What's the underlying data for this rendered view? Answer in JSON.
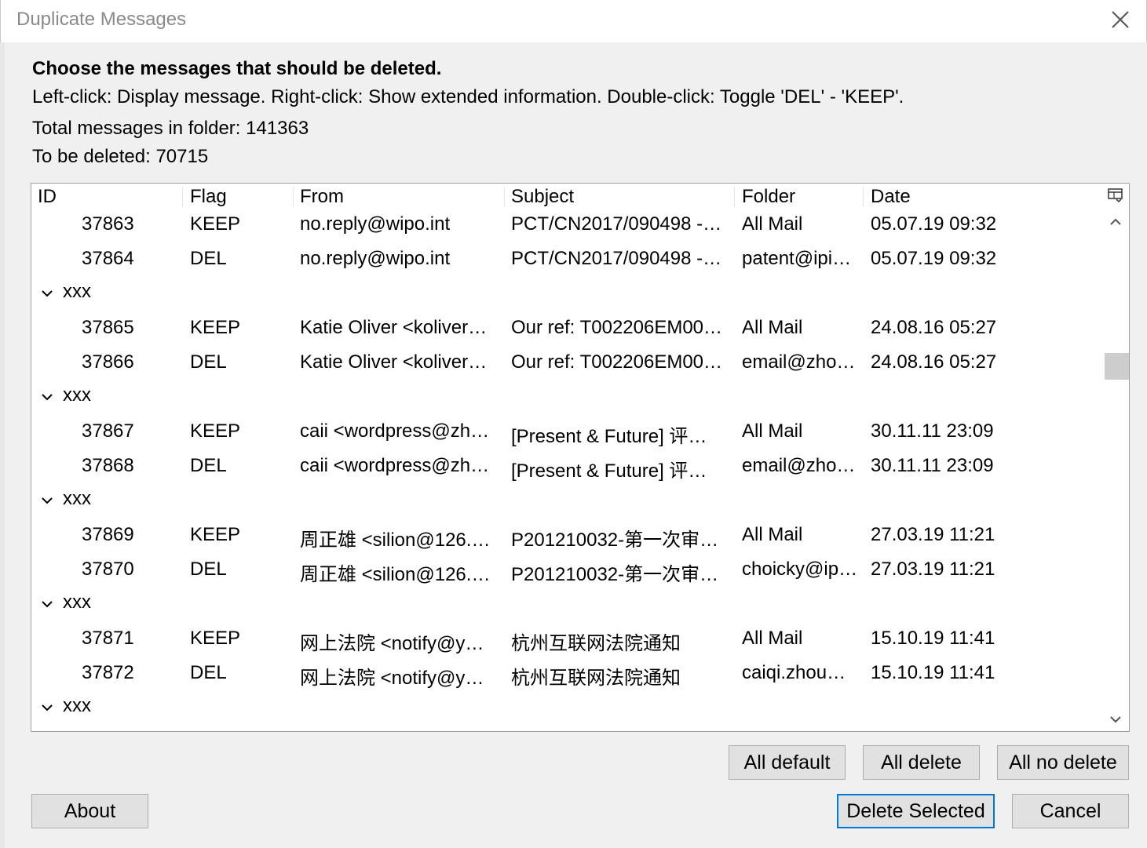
{
  "window": {
    "title": "Duplicate Messages"
  },
  "heading": "Choose the messages that should be deleted.",
  "instructions": "Left-click: Display message. Right-click: Show extended information. Double-click: Toggle 'DEL' - 'KEEP'.",
  "totals": {
    "total_label": "Total messages in folder: 141363",
    "delete_label": "To be deleted: 70715"
  },
  "columns": [
    "ID",
    "Flag",
    "From",
    "Subject",
    "Folder",
    "Date"
  ],
  "group_label": "xxx",
  "rows": [
    {
      "type": "row",
      "id": "37863",
      "flag": "KEEP",
      "from": "no.reply@wipo.int",
      "subject": "PCT/CN2017/090498 -…",
      "folder": "All Mail",
      "date": "05.07.19 09:32"
    },
    {
      "type": "row",
      "id": "37864",
      "flag": "DEL",
      "from": "no.reply@wipo.int",
      "subject": "PCT/CN2017/090498 -…",
      "folder": "patent@ipi…",
      "date": "05.07.19 09:32"
    },
    {
      "type": "group",
      "label": "xxx"
    },
    {
      "type": "row",
      "id": "37865",
      "flag": "KEEP",
      "from": "Katie Oliver <koliver…",
      "subject": "Our ref: T002206EM00…",
      "folder": "All Mail",
      "date": "24.08.16 05:27"
    },
    {
      "type": "row",
      "id": "37866",
      "flag": "DEL",
      "from": "Katie Oliver <koliver…",
      "subject": "Our ref: T002206EM00…",
      "folder": "email@zho…",
      "date": "24.08.16 05:27"
    },
    {
      "type": "group",
      "label": "xxx"
    },
    {
      "type": "row",
      "id": "37867",
      "flag": "KEEP",
      "from": "caii <wordpress@zh…",
      "subject": "[Present & Future] 评…",
      "folder": "All Mail",
      "date": "30.11.11 23:09"
    },
    {
      "type": "row",
      "id": "37868",
      "flag": "DEL",
      "from": "caii <wordpress@zh…",
      "subject": "[Present & Future] 评…",
      "folder": "email@zho…",
      "date": "30.11.11 23:09"
    },
    {
      "type": "group",
      "label": "xxx"
    },
    {
      "type": "row",
      "id": "37869",
      "flag": "KEEP",
      "from": "周正雄 <silion@126.…",
      "subject": "P201210032-第一次审…",
      "folder": "All Mail",
      "date": "27.03.19 11:21"
    },
    {
      "type": "row",
      "id": "37870",
      "flag": "DEL",
      "from": "周正雄 <silion@126.…",
      "subject": "P201210032-第一次审…",
      "folder": "choicky@ip…",
      "date": "27.03.19 11:21"
    },
    {
      "type": "group",
      "label": "xxx"
    },
    {
      "type": "row",
      "id": "37871",
      "flag": "KEEP",
      "from": "网上法院 <notify@y…",
      "subject": "杭州互联网法院通知",
      "folder": "All Mail",
      "date": "15.10.19 11:41"
    },
    {
      "type": "row",
      "id": "37872",
      "flag": "DEL",
      "from": "网上法院 <notify@y…",
      "subject": "杭州互联网法院通知",
      "folder": "caiqi.zhou…",
      "date": "15.10.19 11:41"
    },
    {
      "type": "group",
      "label": "xxx"
    }
  ],
  "buttons": {
    "all_default": "All default",
    "all_delete": "All delete",
    "all_no_delete": "All no delete",
    "about": "About",
    "delete_selected": "Delete Selected",
    "cancel": "Cancel"
  },
  "colors": {
    "focus_border": "#0078d7",
    "button_bg": "#e1e1e1",
    "dialog_bg": "#f0f0f0"
  }
}
